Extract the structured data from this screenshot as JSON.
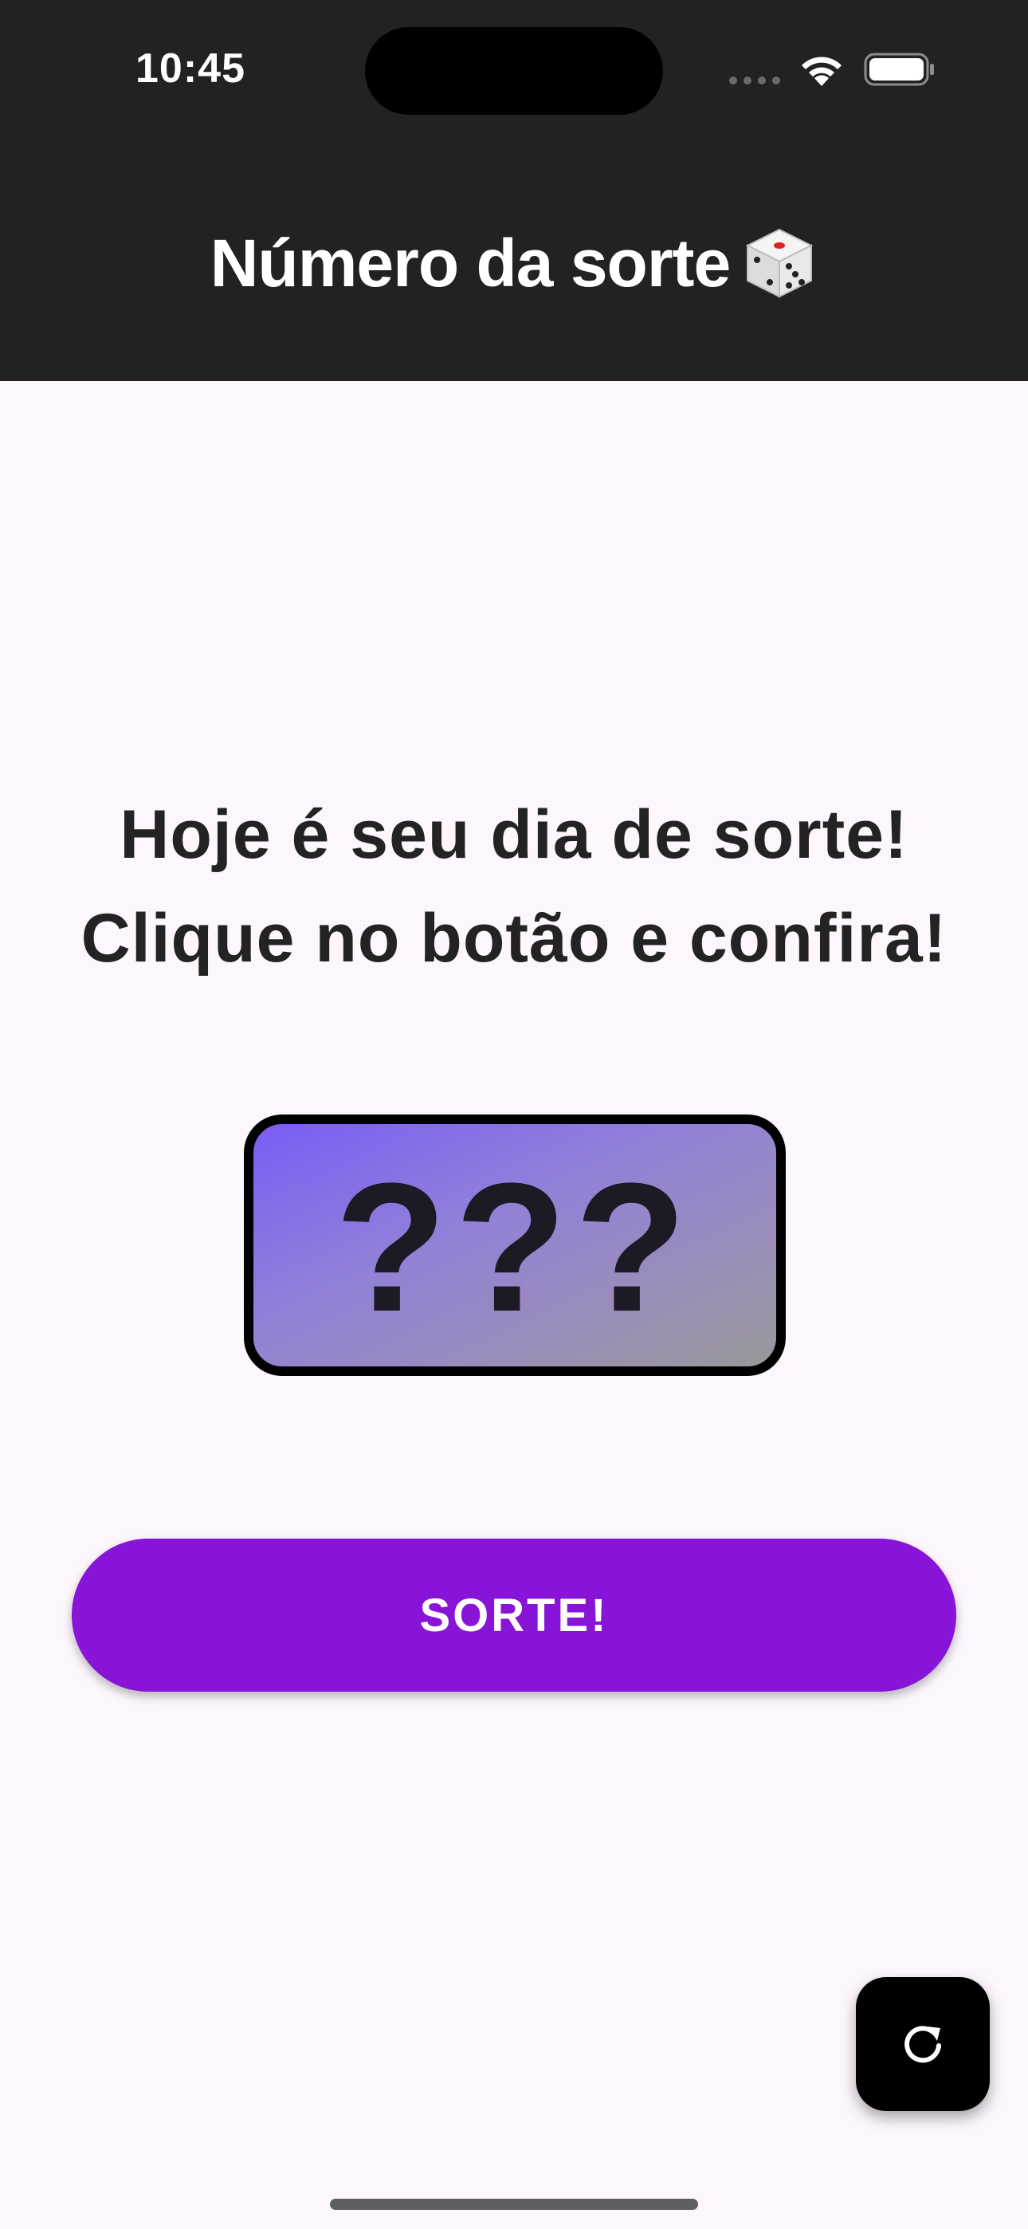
{
  "status_bar": {
    "time": "10:45"
  },
  "app_bar": {
    "title": "Número da sorte",
    "title_icon": "dice-icon"
  },
  "main": {
    "message": "Hoje é seu dia de sorte! Clique no botão e confira!",
    "number_display": "???",
    "button_label": "SORTE!",
    "fab_icon": "refresh-icon"
  },
  "colors": {
    "header_bg": "#222222",
    "page_bg": "#fdf7fd",
    "button_bg": "#8714d6",
    "box_gradient_start": "#7b5cf5",
    "box_gradient_end": "#999999",
    "fab_bg": "#000000"
  }
}
